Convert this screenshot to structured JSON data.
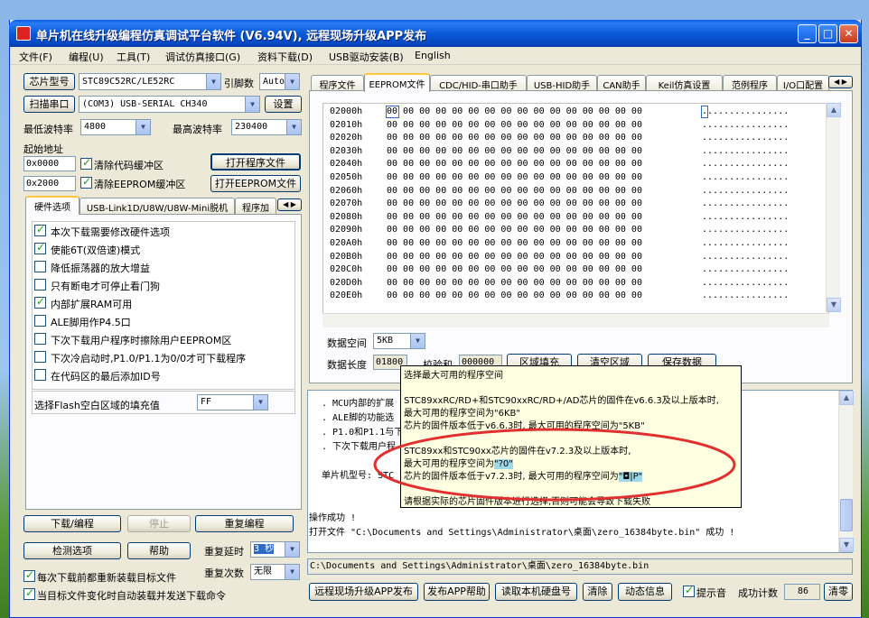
{
  "window": {
    "title": "单片机在线升级编程仿真调试平台软件 (V6.94V), 远程现场升级APP发布"
  },
  "menu": [
    "文件(F)",
    "编程(U)",
    "工具(T)",
    "调试仿真接口(G)",
    "资料下载(D)",
    "USB驱动安装(B)",
    "English"
  ],
  "left": {
    "chip_btn": "芯片型号",
    "chip_value": "STC89C52RC/LE52RC",
    "pins_label": "引脚数",
    "pins_value": "Auto",
    "scan_btn": "扫描串口",
    "port_value": "(COM3) USB-SERIAL CH340",
    "settings_btn": "设置",
    "min_baud_label": "最低波特率",
    "min_baud": "4800",
    "max_baud_label": "最高波特率",
    "max_baud": "230400",
    "start_addr_label": "起始地址",
    "addr1": "0x0000",
    "clear_code": "清除代码缓冲区",
    "open_prog_btn": "打开程序文件",
    "addr2": "0x2000",
    "clear_eeprom": "清除EEPROM缓冲区",
    "open_eeprom_btn": "打开EEPROM文件",
    "tabs": [
      "硬件选项",
      "USB-Link1D/U8W/U8W-Mini脱机",
      "程序加"
    ],
    "options": [
      {
        "label": "本次下载需要修改硬件选项",
        "checked": true
      },
      {
        "label": "使能6T(双倍速)模式",
        "checked": true
      },
      {
        "label": "降低振荡器的放大增益",
        "checked": false
      },
      {
        "label": "只有断电才可停止看门狗",
        "checked": false
      },
      {
        "label": "内部扩展RAM可用",
        "checked": true
      },
      {
        "label": "ALE脚用作P4.5口",
        "checked": false
      },
      {
        "label": "下次下载用户程序时擦除用户EEPROM区",
        "checked": false
      },
      {
        "label": "下次冷启动时,P1.0/P1.1为0/0才可下载程序",
        "checked": false
      },
      {
        "label": "在代码区的最后添加ID号",
        "checked": false
      }
    ],
    "fill_label": "选择Flash空白区域的填充值",
    "fill_value": "FF",
    "download_btn": "下载/编程",
    "stop_btn": "停止",
    "repeat_btn": "重复编程",
    "check_btn": "检测选项",
    "help_btn": "帮助",
    "delay_label": "重复延时",
    "delay_value": "3 秒",
    "count_label": "重复次数",
    "count_value": "无限",
    "reload_label": "每次下载前都重新装载目标文件",
    "auto_label": "当目标文件变化时自动装载并发送下载命令"
  },
  "right": {
    "tabs": [
      "程序文件",
      "EEPROM文件",
      "CDC/HID-串口助手",
      "USB-HID助手",
      "CAN助手",
      "Keil仿真设置",
      "范例程序",
      "I/O口配置"
    ],
    "hex_addrs": [
      "02000h",
      "02010h",
      "02020h",
      "02030h",
      "02040h",
      "02050h",
      "02060h",
      "02070h",
      "02080h",
      "02090h",
      "020A0h",
      "020B0h",
      "020C0h",
      "020D0h",
      "020E0h"
    ],
    "hex_bytes": "00 00 00 00 00 00 00 00 00 00 00 00 00 00 00 00",
    "hex_ascii": "................",
    "space_label": "数据空间",
    "space_value": "5KB",
    "len_label": "数据长度",
    "len_value": "01800",
    "checksum_label": "校验和",
    "checksum_value": "000000",
    "fill_btn": "区域填充",
    "clear_btn": "清空区域",
    "save_btn": "保存数据",
    "log_lines": [
      ". MCU内部的扩展",
      ". ALE脚的功能选",
      ". P1.0和P1.1与下",
      ". 下次下载用户程"
    ],
    "chip_model_label": "单片机型号: STC",
    "status1": "操作成功 !",
    "status2": "打开文件 \"C:\\Documents and Settings\\Administrator\\桌面\\zero_16384byte.bin\" 成功 !",
    "path": "C:\\Documents and Settings\\Administrator\\桌面\\zero_16384byte.bin",
    "btn_publish": "远程现场升级APP发布",
    "btn_publish_help": "发布APP帮助",
    "btn_read_disk": "读取本机硬盘号",
    "btn_clear": "清除",
    "btn_anim": "动态信息",
    "beep_label": "提示音",
    "success_label": "成功计数",
    "success_value": "86",
    "clear_zero": "清零"
  },
  "tooltip": {
    "l1": "选择最大可用的程序空间",
    "l2": "STC89xxRC/RD+和STC90xxRC/RD+/AD芯片的固件在v6.6.3及以上版本时,",
    "l3": "最大可用的程序空间为\"6KB\"",
    "l4": "芯片的固件版本低于v6.6.3时, 最大可用的程序空间为\"5KB\"",
    "l5": "STC89xx和STC90xx芯片的固件在v7.2.3及以上版本时,",
    "l6a": "最大可用的程序空间为",
    "l6b": "\"?0\"",
    "l7a": "芯片的固件版本低于v7.2.3时, 最大可用的程序空间为",
    "l7b": "\"◘|P\"",
    "l8": "请根据实际的芯片固件版本进行选择,否则可能会导致下载失败"
  },
  "colors": {
    "title_bar": "#0a58e8",
    "highlight_ellipse": "#e03030",
    "tooltip_bg": "#ffffe1"
  }
}
